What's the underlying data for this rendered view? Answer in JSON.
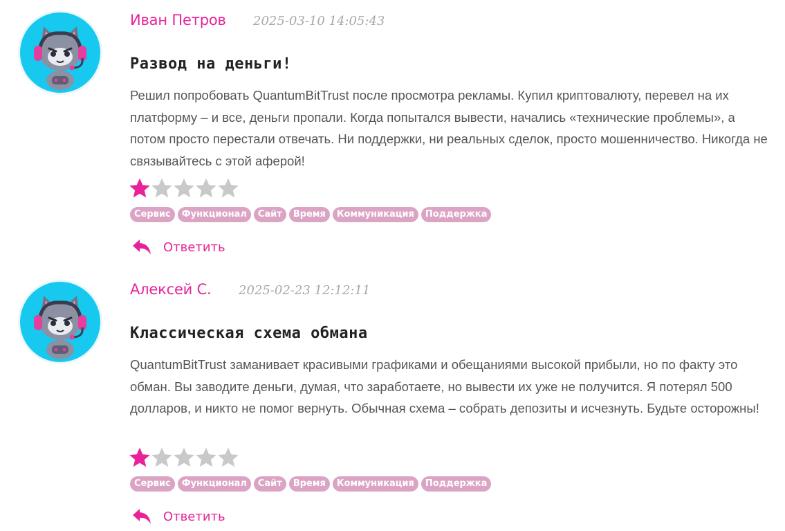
{
  "colors": {
    "accent": "#e8239a",
    "star_filled": "#e8239a",
    "star_empty": "#c9c9c9",
    "tag_bg": "#dba3c4",
    "avatar_bg": "#17c8ef"
  },
  "reviews": [
    {
      "author": "Иван Петров",
      "date": "2025-03-10 14:05:43",
      "title": "Развод на деньги!",
      "body": "Решил попробовать QuantumBitTrust после просмотра рекламы. Купил криптовалюту, перевел на их платформу – и все, деньги пропали. Когда попытался вывести, начались «технические проблемы», а потом просто перестали отвечать. Ни поддержки, ни реальных сделок, просто мошенничество. Никогда не связывайтесь с этой аферой!",
      "rating": 1,
      "rating_max": 5,
      "tags": [
        "Сервис",
        "Функционал",
        "Сайт",
        "Время",
        "Коммуникация",
        "Поддержка"
      ],
      "reply_label": "Ответить",
      "avatar_icon": "cat-gamer-avatar-icon"
    },
    {
      "author": "Алексей С.",
      "date": "2025-02-23 12:12:11",
      "title": "Классическая схема обмана",
      "body": "QuantumBitTrust заманивает красивыми графиками и обещаниями высокой прибыли, но по факту это обман. Вы заводите деньги, думая, что заработаете, но вывести их уже не получится. Я потерял 500 долларов, и никто не помог вернуть. Обычная схема – собрать депозиты и исчезнуть. Будьте осторожны!",
      "rating": 1,
      "rating_max": 5,
      "tags": [
        "Сервис",
        "Функционал",
        "Сайт",
        "Время",
        "Коммуникация",
        "Поддержка"
      ],
      "reply_label": "Ответить",
      "avatar_icon": "cat-gamer-avatar-icon"
    }
  ]
}
